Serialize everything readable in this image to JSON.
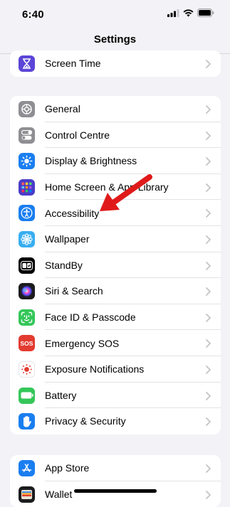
{
  "status_bar": {
    "time": "6:40"
  },
  "nav": {
    "title": "Settings"
  },
  "groups": {
    "top": [
      {
        "label": "Screen Time",
        "icon": "hourglass-icon",
        "color": "#5b45d6"
      }
    ],
    "main": [
      {
        "label": "General",
        "icon": "gear-icon",
        "color": "#8e8e93"
      },
      {
        "label": "Control Centre",
        "icon": "toggles-icon",
        "color": "#8e8e93"
      },
      {
        "label": "Display & Brightness",
        "icon": "sun-icon",
        "color": "#1a7ef0"
      },
      {
        "label": "Home Screen & App Library",
        "icon": "app-grid-icon",
        "color": "#4a3cc8"
      },
      {
        "label": "Accessibility",
        "icon": "accessibility-icon",
        "color": "#1a7ef0"
      },
      {
        "label": "Wallpaper",
        "icon": "flower-icon",
        "color": "#38aef0"
      },
      {
        "label": "StandBy",
        "icon": "standby-icon",
        "color": "#000000"
      },
      {
        "label": "Siri & Search",
        "icon": "siri-icon",
        "color": "#1c1c1e"
      },
      {
        "label": "Face ID & Passcode",
        "icon": "face-id-icon",
        "color": "#34c759"
      },
      {
        "label": "Emergency SOS",
        "icon": "sos-icon",
        "color": "#e33b30",
        "icon_text": "SOS"
      },
      {
        "label": "Exposure Notifications",
        "icon": "exposure-icon",
        "color": "#ffffff"
      },
      {
        "label": "Battery",
        "icon": "battery-icon",
        "color": "#34c759"
      },
      {
        "label": "Privacy & Security",
        "icon": "hand-icon",
        "color": "#1a7ef0"
      }
    ],
    "bottom": [
      {
        "label": "App Store",
        "icon": "app-store-icon",
        "color": "#1a7ef0"
      },
      {
        "label": "Wallet",
        "icon": "wallet-icon",
        "color": "#1c1c1e"
      }
    ]
  },
  "annotation": {
    "arrow_color": "#e01a1a"
  }
}
